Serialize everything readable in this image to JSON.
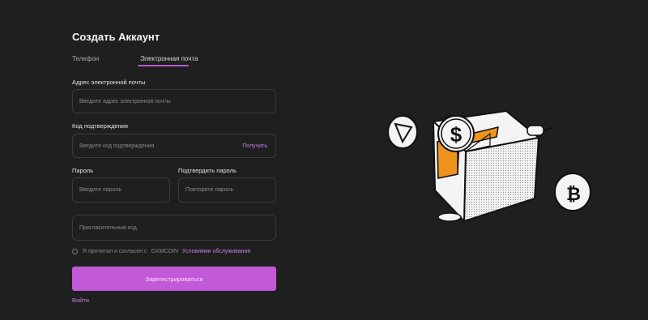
{
  "form": {
    "title": "Создать Аккаунт",
    "tabs": [
      {
        "label": "Телефон",
        "active": false
      },
      {
        "label": "Электронная почта",
        "active": true
      }
    ],
    "email": {
      "label": "Адрес электронной почты",
      "placeholder": "Введите адрес электронной почты",
      "value": ""
    },
    "code": {
      "label": "Код подтверждения",
      "placeholder": "Введите код подтверждения",
      "value": "",
      "get_label": "Получить"
    },
    "password": {
      "label": "Пароль",
      "placeholder": "Введите пароль",
      "value": ""
    },
    "confirm": {
      "label": "Подтвердить пароль",
      "placeholder": "Повторите пароль",
      "value": ""
    },
    "invite": {
      "placeholder": "Пригласительный код",
      "value": ""
    },
    "agree": {
      "text": "Я прочитал и согласен с",
      "brand": "GXMCOIN",
      "link": "Условиями обслуживания",
      "checked": false
    },
    "register_label": "Зарегистрироваться",
    "login_label": "Войти"
  },
  "colors": {
    "accent": "#c259d8",
    "background": "#1f1f20",
    "orange": "#f0921e"
  },
  "illustration": {
    "icons": [
      "tron-coin-icon",
      "dollar-coin-icon",
      "bitcoin-coin-icon",
      "safe-box-icon"
    ],
    "coin_symbol": "$"
  }
}
